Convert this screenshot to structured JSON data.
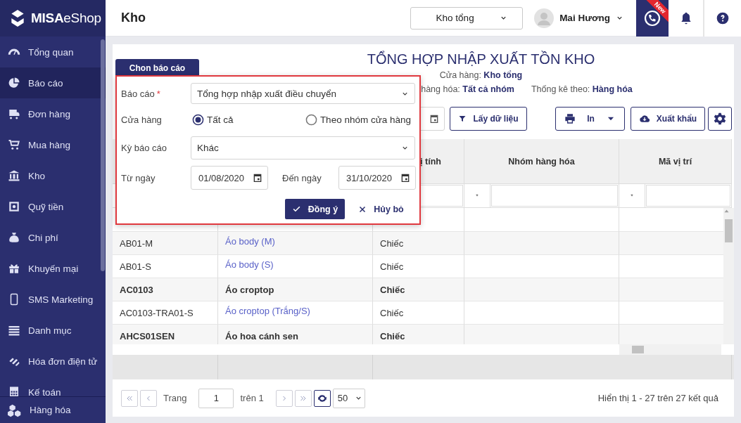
{
  "sidebar": {
    "logo": "**MISA**eShop",
    "items": [
      {
        "label": "Tổng quan",
        "selected": false
      },
      {
        "label": "Báo cáo",
        "selected": true
      },
      {
        "label": "Đơn hàng",
        "selected": false
      },
      {
        "label": "Mua hàng",
        "selected": false
      },
      {
        "label": "Kho",
        "selected": false
      },
      {
        "label": "Quỹ tiền",
        "selected": false
      },
      {
        "label": "Chi phí",
        "selected": false
      },
      {
        "label": "Khuyến mại",
        "selected": false
      },
      {
        "label": "SMS Marketing",
        "selected": false
      },
      {
        "label": "Danh mục",
        "selected": false
      },
      {
        "label": "Hóa đơn điện tử",
        "selected": false
      },
      {
        "label": "Kế toán",
        "selected": false
      }
    ],
    "pinned_item": {
      "label": "Hàng hóa"
    }
  },
  "header": {
    "title": "Kho",
    "store_select": "Kho tổng",
    "user_name": "Mai Hương",
    "new_badge": "New"
  },
  "report": {
    "tab": "Chon báo cáo",
    "title": "TỔNG HỢP NHẬP XUẤT TỒN KHO",
    "meta_lines": [
      [
        "Cửa hàng: **Kho tổng**"
      ],
      [
        "hàng hóa: **Tất cả nhóm**",
        "Thống kê theo: **Hàng hóa**"
      ]
    ],
    "fetch_button": "Lấy dữ liệu",
    "print_button": "In",
    "export_button": "Xuất khẩu"
  },
  "table": {
    "columns": [
      {
        "label": "ị tính"
      },
      {
        "label": "Nhóm hàng hóa"
      },
      {
        "label": "Mã vị trí"
      }
    ],
    "filter_markers": [
      "*",
      "*"
    ],
    "rows": [
      {
        "kind": "item",
        "code": "AB01-M",
        "name": "Áo body (M)",
        "unit": "Chiếc"
      },
      {
        "kind": "item",
        "code": "AB01-S",
        "name": "Áo body (S)",
        "unit": "Chiếc"
      },
      {
        "kind": "group",
        "code": "AC0103",
        "name": "Áo croptop",
        "unit": "Chiếc"
      },
      {
        "kind": "item",
        "code": "AC0103-TRA01-S",
        "name": "Áo croptop (Trắng/S)",
        "unit": "Chiếc"
      },
      {
        "kind": "group",
        "code": "AHCS01SEN",
        "name": "Áo hoa cánh sen",
        "unit": "Chiếc"
      }
    ]
  },
  "pager": {
    "page_label": "Trang",
    "page": "1",
    "of_label": "trên 1",
    "page_size": "50",
    "summary": "Hiển thị 1 - 27 trên 27 kết quả"
  },
  "popup": {
    "report_label": "Báo cáo",
    "required_mark": "*",
    "report_value": "Tổng hợp nhập xuất điều chuyển",
    "store_label": "Cửa hàng",
    "store_options": [
      {
        "label": "Tất cả",
        "selected": true
      },
      {
        "label": "Theo nhóm cửa hàng",
        "selected": false
      }
    ],
    "period_label": "Kỳ báo cáo",
    "period_value": "Khác",
    "from_label": "Từ ngày",
    "from_value": "01/08/2020",
    "to_label": "Đến ngày",
    "to_value": "31/10/2020",
    "ok_button": "Đồng ý",
    "cancel_button": "Hủy bỏ"
  }
}
